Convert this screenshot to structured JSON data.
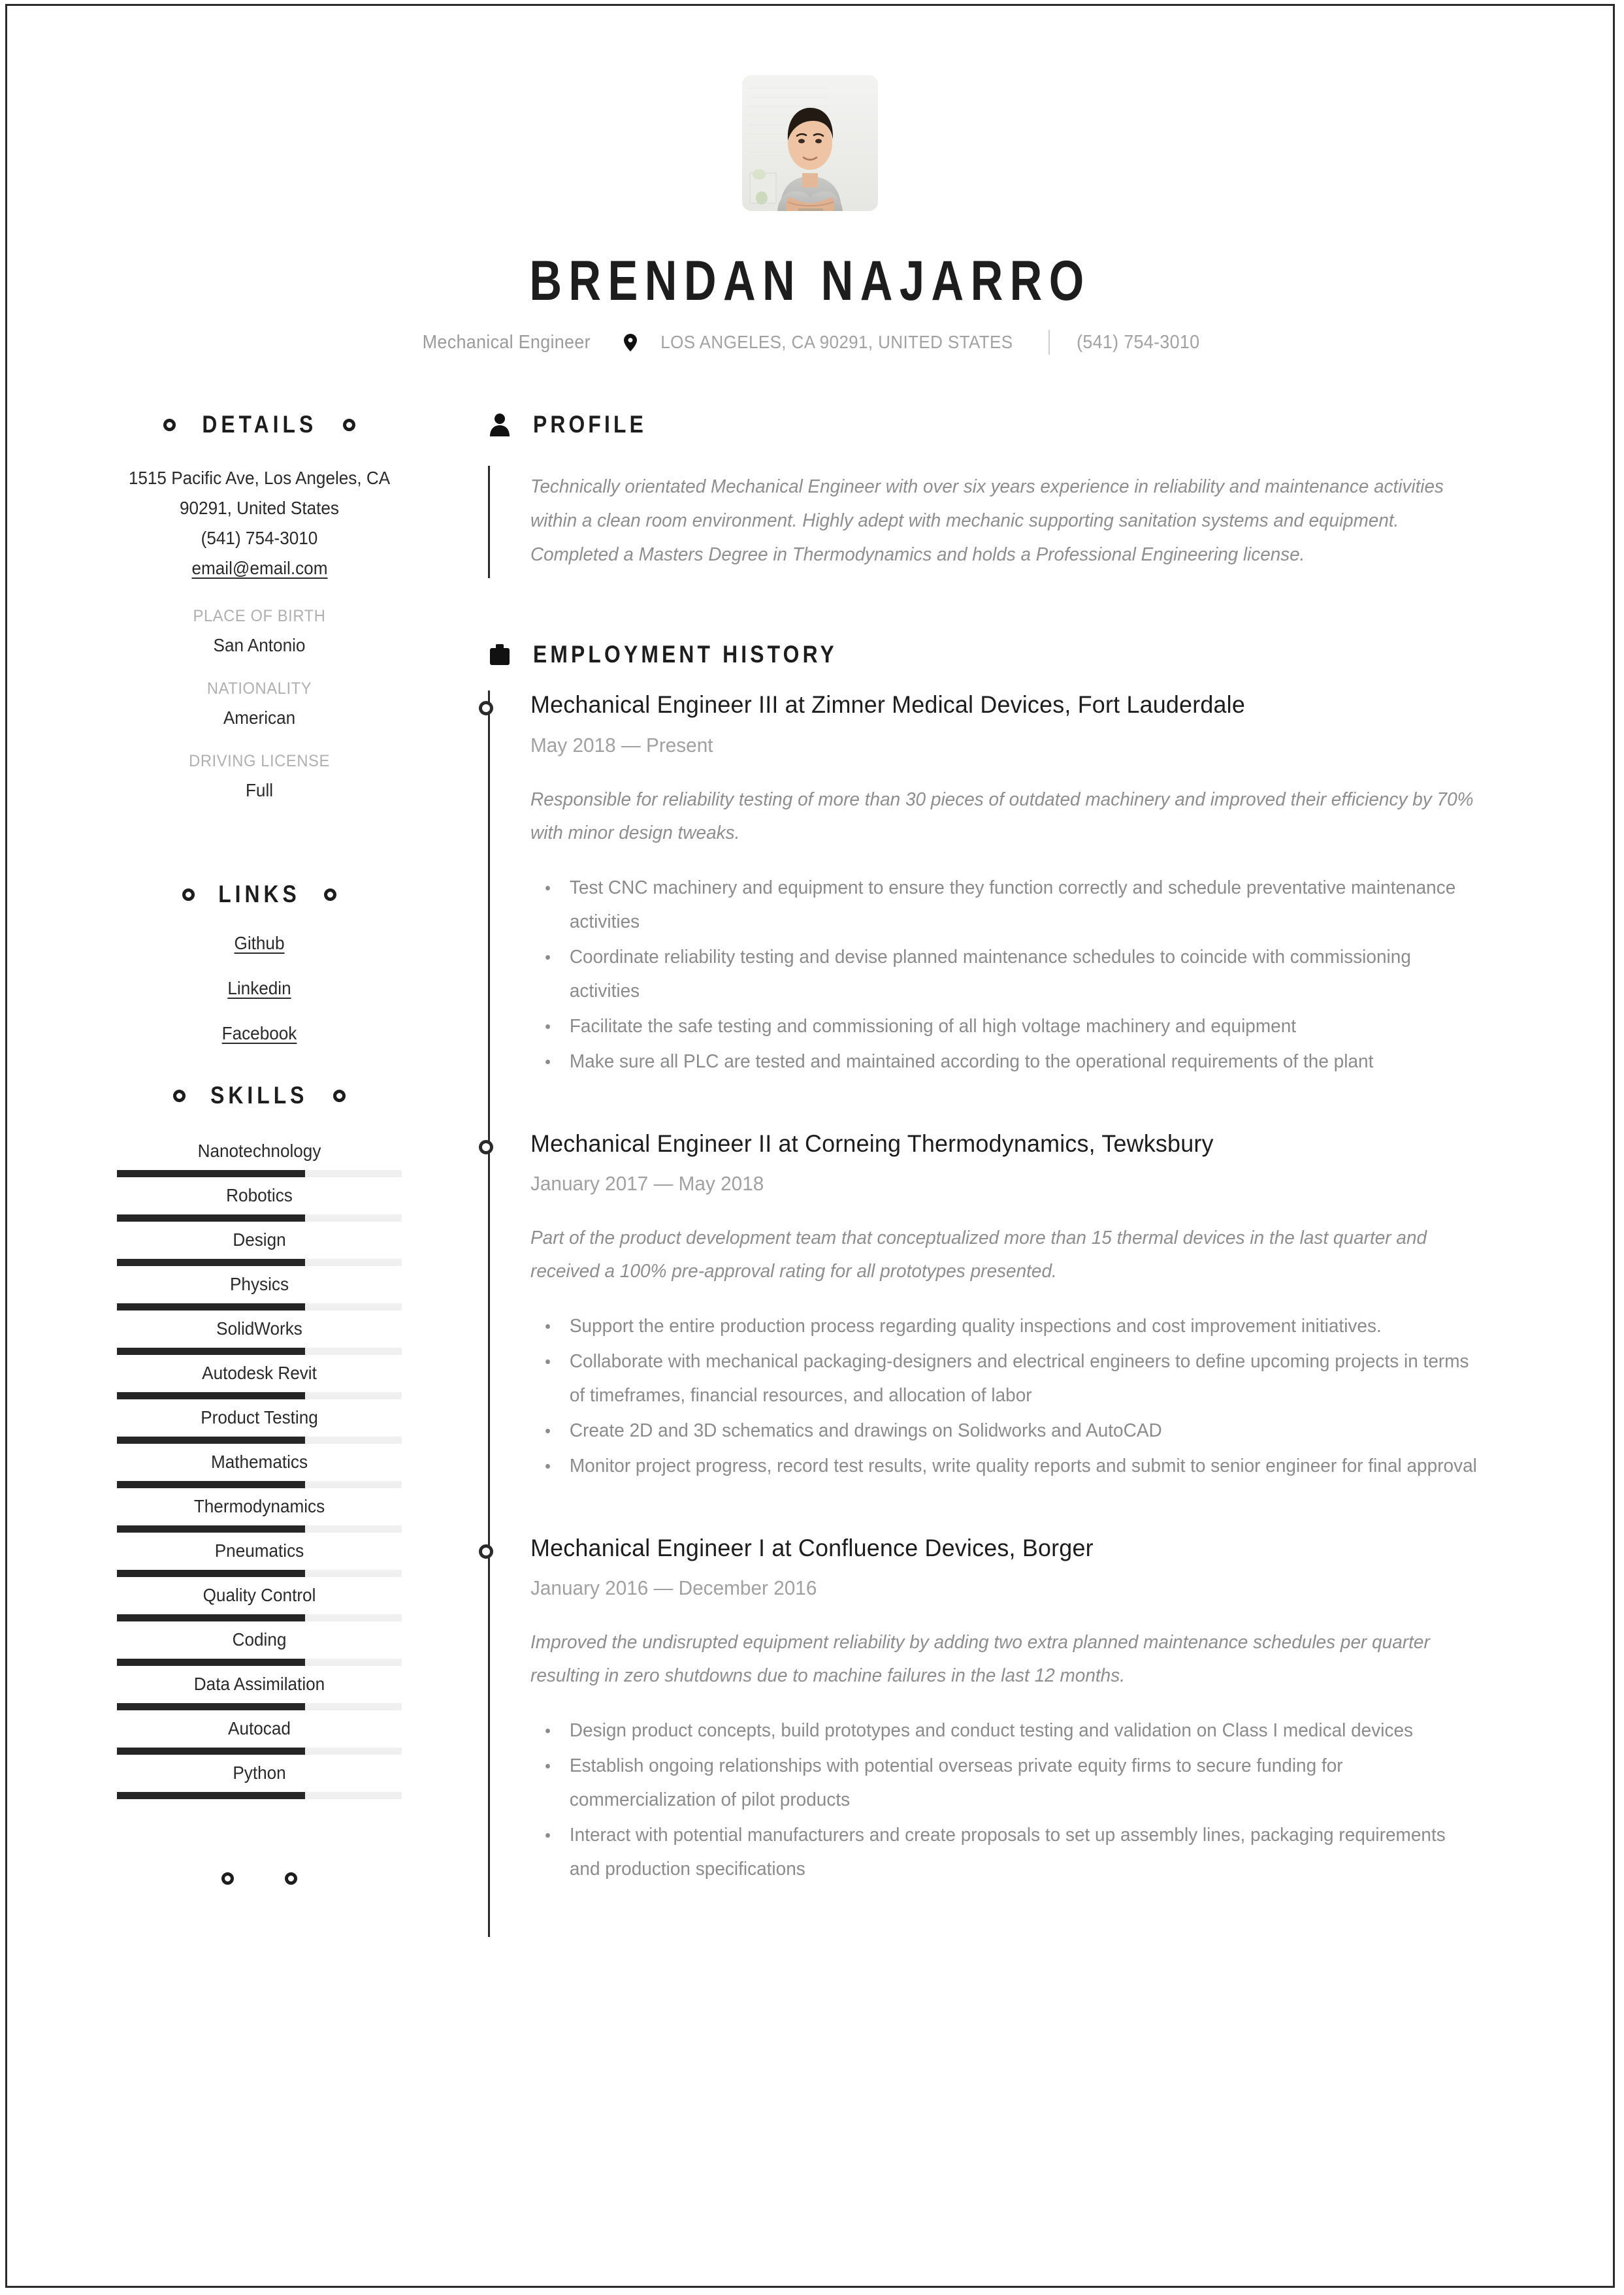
{
  "header": {
    "photo_alt": "profile-photo",
    "full_name": "BRENDAN NAJARRO",
    "job_title": "Mechanical Engineer",
    "location": "LOS ANGELES, CA 90291, UNITED STATES",
    "phone": "(541) 754-3010"
  },
  "sidebar": {
    "details": {
      "heading": "DETAILS",
      "address_line1": "1515 Pacific Ave, Los Angeles, CA",
      "address_line2": "90291, United States",
      "phone": "(541) 754-3010",
      "email": "email@email.com",
      "fields": [
        {
          "label": "PLACE OF BIRTH",
          "value": "San Antonio"
        },
        {
          "label": "NATIONALITY",
          "value": "American"
        },
        {
          "label": "DRIVING LICENSE",
          "value": "Full"
        }
      ]
    },
    "links": {
      "heading": "LINKS",
      "items": [
        "Github",
        "Linkedin",
        "Facebook"
      ]
    },
    "skills": {
      "heading": "SKILLS",
      "items": [
        {
          "name": "Nanotechnology",
          "level": 66
        },
        {
          "name": "Robotics",
          "level": 66
        },
        {
          "name": "Design",
          "level": 66
        },
        {
          "name": "Physics",
          "level": 66
        },
        {
          "name": "SolidWorks",
          "level": 66
        },
        {
          "name": "Autodesk Revit",
          "level": 66
        },
        {
          "name": "Product Testing",
          "level": 66
        },
        {
          "name": "Mathematics",
          "level": 66
        },
        {
          "name": "Thermodynamics",
          "level": 66
        },
        {
          "name": "Pneumatics",
          "level": 66
        },
        {
          "name": "Quality Control",
          "level": 66
        },
        {
          "name": "Coding",
          "level": 66
        },
        {
          "name": "Data Assimilation",
          "level": 66
        },
        {
          "name": "Autocad",
          "level": 66
        },
        {
          "name": "Python",
          "level": 66
        }
      ]
    }
  },
  "main": {
    "profile": {
      "heading": "PROFILE",
      "text": " Technically orientated Mechanical Engineer with over six years experience in reliability and maintenance activities within a clean room environment. Highly adept with mechanic supporting sanitation systems and equipment. Completed a Masters Degree in Thermodynamics and holds a Professional Engineering license."
    },
    "employment": {
      "heading": "EMPLOYMENT HISTORY",
      "jobs": [
        {
          "title": "Mechanical Engineer III  at  Zimner Medical Devices, Fort Lauderdale",
          "dates": "May 2018 — Present",
          "summary": "Responsible for reliability testing of more than 30 pieces of outdated machinery and improved their efficiency by 70% with minor design tweaks.",
          "bullets": [
            "Test CNC machinery and equipment to ensure they function correctly and schedule preventative maintenance activities",
            "Coordinate reliability testing and devise planned maintenance schedules to coincide with commissioning activities",
            "Facilitate the safe testing and commissioning of all high voltage machinery and equipment",
            "Make sure all PLC are tested and maintained according to the operational requirements of the plant"
          ]
        },
        {
          "title": "Mechanical Engineer II at  Corneing Thermodynamics, Tewksbury",
          "dates": "January 2017 — May 2018",
          "summary": "Part of the product development team that conceptualized more than 15 thermal devices in the last quarter and received a 100% pre-approval rating for all prototypes presented.",
          "bullets": [
            "Support the entire production process regarding quality inspections and cost improvement initiatives.",
            "Collaborate with mechanical packaging-designers and electrical engineers to define upcoming projects in terms of timeframes, financial resources, and allocation of labor",
            "Create 2D and 3D schematics and drawings on Solidworks and AutoCAD",
            "Monitor project progress, record test results, write quality reports and submit to senior engineer for final approval"
          ]
        },
        {
          "title": "Mechanical Engineer I at  Confluence Devices, Borger",
          "dates": "January 2016 — December 2016",
          "summary": "Improved the undisrupted equipment reliability by adding two extra planned maintenance schedules per quarter resulting in zero shutdowns due to machine failures in the last 12 months.",
          "bullets": [
            "Design product concepts, build prototypes and conduct testing and validation on Class I medical devices",
            "Establish ongoing relationships with potential overseas private equity firms to secure funding for commercialization of pilot products",
            "Interact with potential manufacturers and create proposals to set up assembly lines, packaging requirements and production specifications"
          ]
        }
      ]
    }
  },
  "colors": {
    "ink": "#1d1d1d",
    "muted": "#8e8e8e",
    "light": "#b0b0b0",
    "track": "#f0f0f0",
    "fill": "#262626"
  }
}
